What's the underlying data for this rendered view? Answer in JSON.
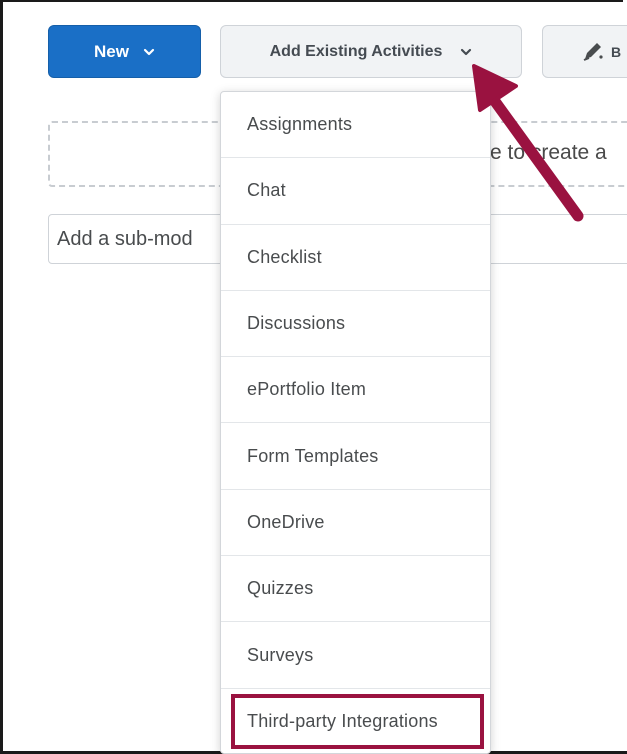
{
  "toolbar": {
    "new_label": "New",
    "add_existing_label": "Add Existing Activities",
    "third_button_label": "B"
  },
  "drop_zone": {
    "text": "e to create a"
  },
  "submodule": {
    "placeholder": "Add a sub-mod"
  },
  "menu": {
    "items": [
      "Assignments",
      "Chat",
      "Checklist",
      "Discussions",
      "ePortfolio Item",
      "Form Templates",
      "OneDrive",
      "Quizzes",
      "Surveys",
      "Third-party Integrations"
    ],
    "highlighted_index": 9
  },
  "colors": {
    "primary": "#1a6fc6",
    "annotation": "#9a1240",
    "text": "#494c4e"
  },
  "icons": {
    "new_chevron": "chevron-down-icon",
    "add_chevron": "chevron-down-icon",
    "third_button": "pencil-sparkle-icon",
    "annotation": "arrow-annotation-icon"
  }
}
